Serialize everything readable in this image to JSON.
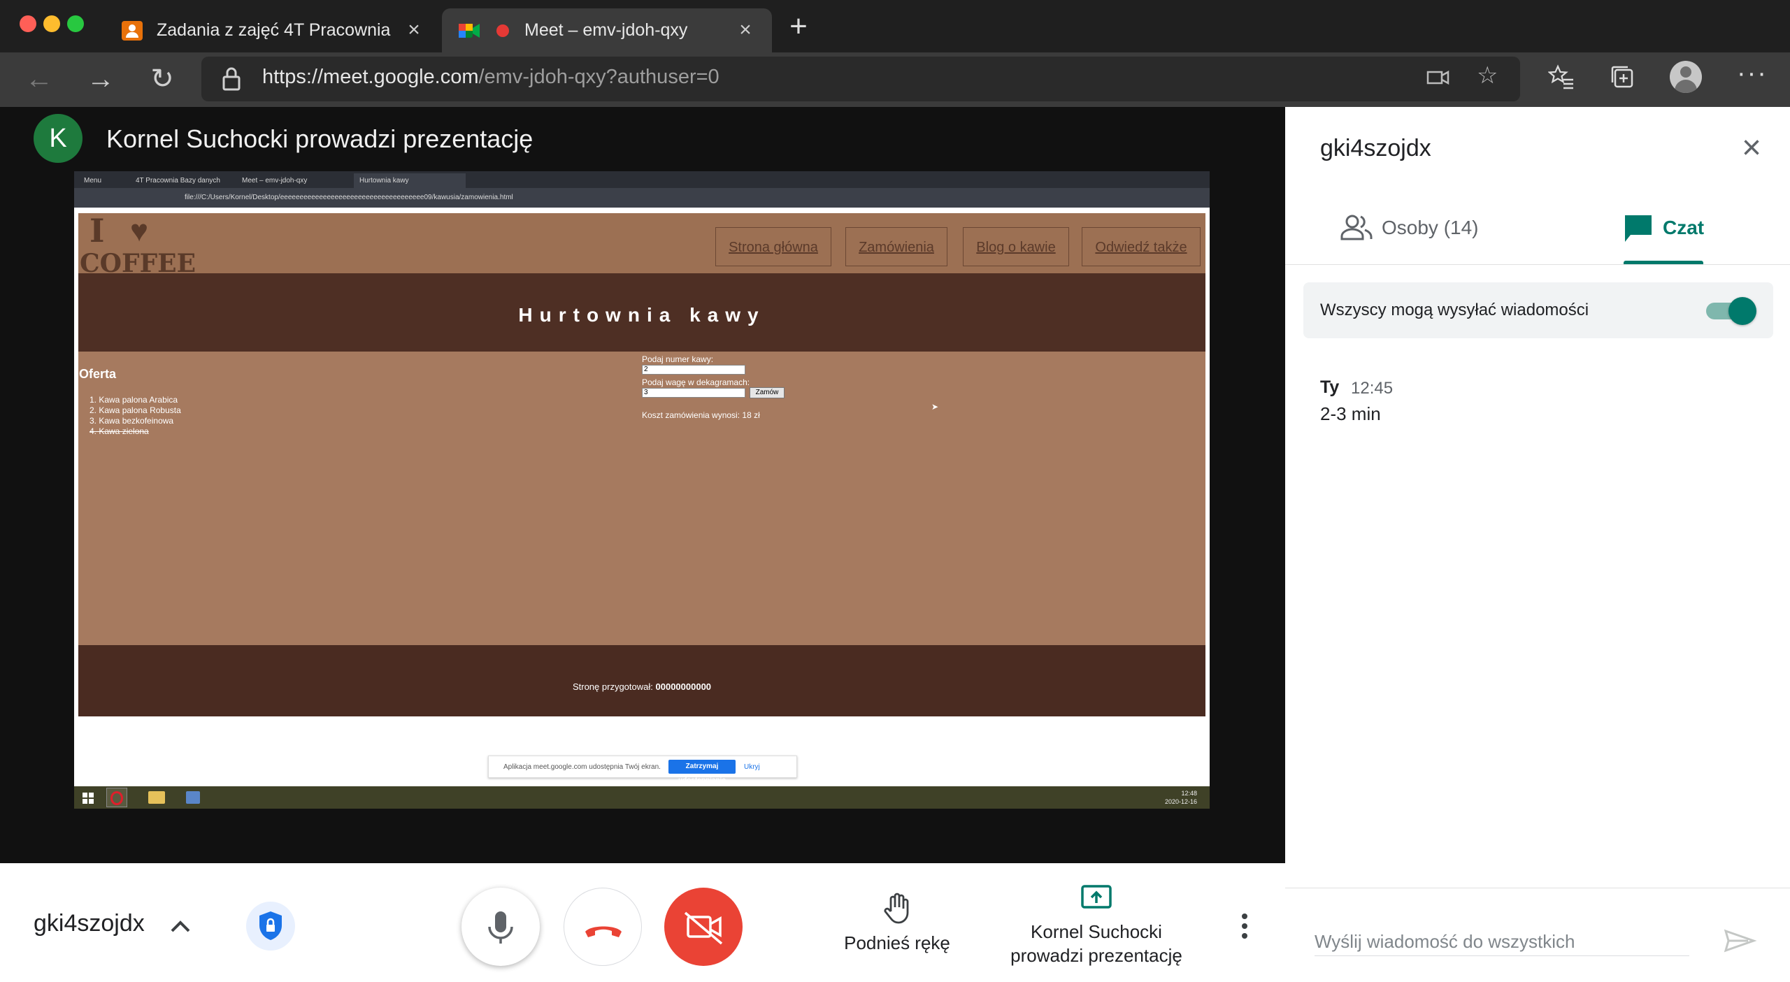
{
  "browser": {
    "tabs": [
      {
        "title": "Zadania z zajęć 4T Pracownia"
      },
      {
        "title": "Meet – emv-jdoh-qxy"
      }
    ],
    "url_host": "https://meet.google.com",
    "url_path": "/emv-jdoh-qxy?authuser=0"
  },
  "stage": {
    "avatar_letter": "K",
    "presenter_title": "Kornel Suchocki prowadzi prezentację"
  },
  "shared_screen": {
    "tabs": [
      "Menu",
      "4T Pracownia Bazy danych",
      "Meet – emv-jdoh-qxy",
      "Hurtownia kawy"
    ],
    "url": "file:///C:/Users/Kornel/Desktop/eeeeeeeeeeeeeeeeeeeeeeeeeeeeeeeeeeeee09/kawusia/zamowienia.html",
    "logo_line1": "I",
    "logo_line2": "COFFEE",
    "nav": [
      "Strona główna",
      "Zamówienia",
      "Blog o kawie",
      "Odwiedź także"
    ],
    "site_title": "Hurtownia kawy",
    "oferta_heading": "Oferta",
    "oferta_items": [
      "1. Kawa palona Arabica",
      "2. Kawa palona Robusta",
      "3. Kawa bezkofeinowa",
      "4. Kawa zielona"
    ],
    "form": {
      "label_number": "Podaj numer kawy:",
      "value_number": "2",
      "label_weight": "Podaj wagę w dekagramach:",
      "value_weight": "3",
      "button": "Zamów",
      "result": "Koszt zamówienia wynosi: 18 zł"
    },
    "footer_label": "Stronę przygotował:",
    "footer_author": "00000000000",
    "share_msg": "Aplikacja meet.google.com udostępnia Twój ekran.",
    "share_stop": "Zatrzymaj udostępnianie",
    "share_hide": "Ukryj",
    "clock_time": "12:48",
    "clock_date": "2020-12-16"
  },
  "panel": {
    "title": "gki4szojdx",
    "tab_people": "Osoby (14)",
    "tab_chat": "Czat",
    "toggle_label": "Wszyscy mogą wysyłać wiadomości",
    "toggle_on": true,
    "messages": [
      {
        "sender": "Ty",
        "time": "12:45",
        "text": "2-3 min"
      }
    ],
    "input_placeholder": "Wyślij wiadomość do wszystkich"
  },
  "bottombar": {
    "meeting_code": "gki4szojdx",
    "raise_hand": "Podnieś rękę",
    "presenting_line1": "Kornel Suchocki",
    "presenting_line2": "prowadzi prezentację"
  },
  "colors": {
    "accent": "#00796b",
    "hangup": "#ea4335",
    "blue": "#1a73e8"
  }
}
